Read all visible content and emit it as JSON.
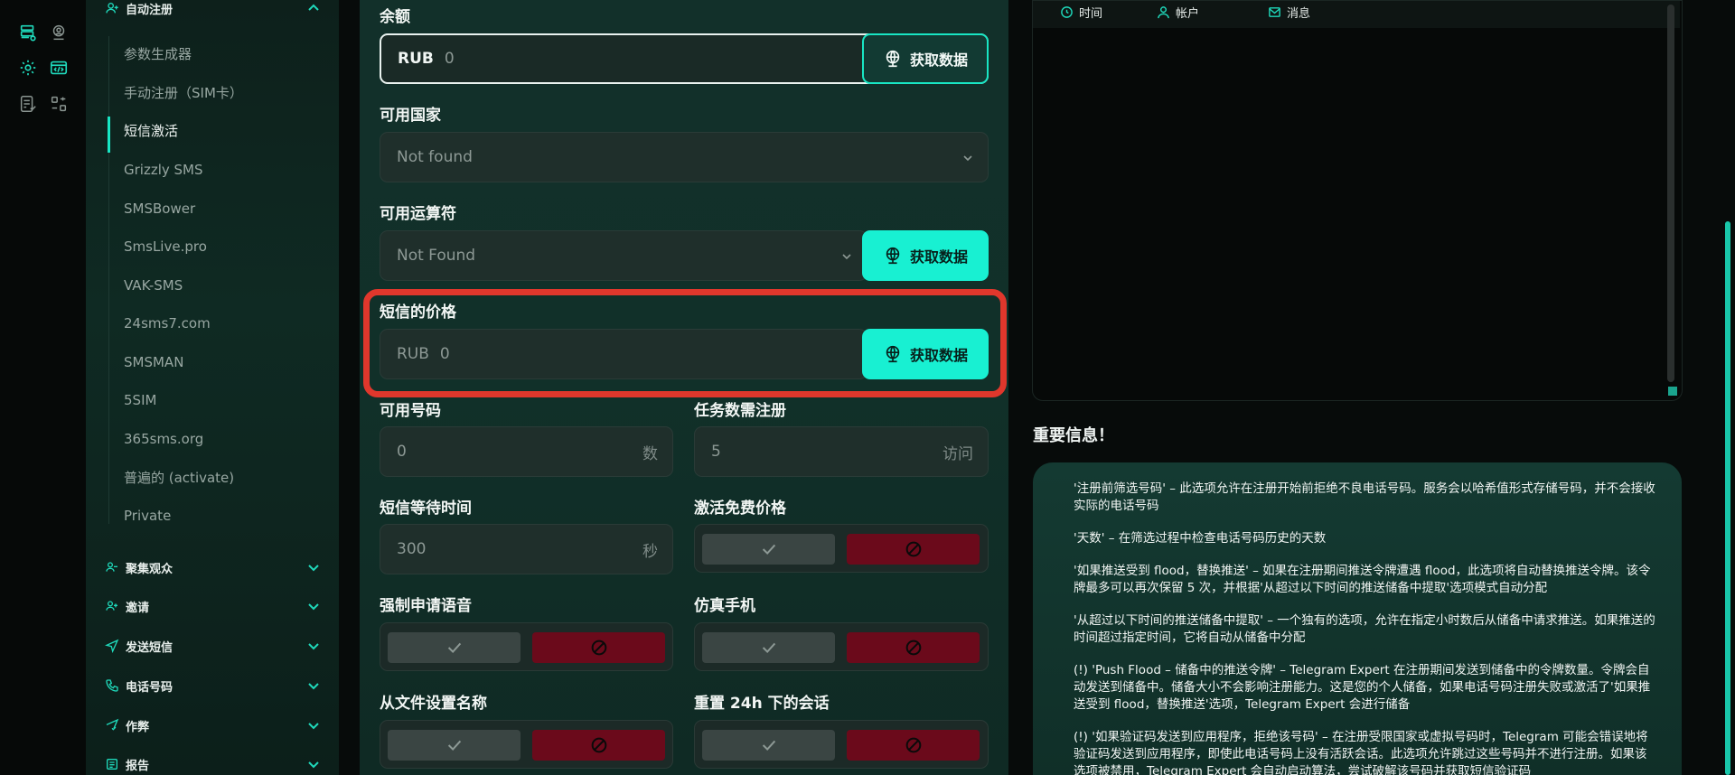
{
  "rail": {
    "icons": [
      "database-icon",
      "user-location-icon",
      "gear-icon",
      "code-window-icon",
      "checklist-icon",
      "layout-icon"
    ]
  },
  "sidebar": {
    "auto_register": "自动注册",
    "sub_items": [
      "参数生成器",
      "手动注册（SIM卡）",
      "短信激活",
      "Grizzly SMS",
      "SMSBower",
      "SmsLive.pro",
      "VAK-SMS",
      "24sms7.com",
      "SMSMAN",
      "5SIM",
      "365sms.org",
      "普遍的 (activate)",
      "Private"
    ],
    "sections": [
      "聚集观众",
      "邀请",
      "发送短信",
      "电话号码",
      "作弊",
      "报告"
    ]
  },
  "form": {
    "balance_label": "余额",
    "balance_prefix": "RUB",
    "balance_value": "0",
    "fetch_label": "获取数据",
    "countries_label": "可用国家",
    "countries_value": "Not found",
    "operators_label": "可用运算符",
    "operators_value": "Not Found",
    "sms_price_label": "短信的价格",
    "sms_price_prefix": "RUB",
    "sms_price_value": "0",
    "available_numbers_label": "可用号码",
    "available_numbers_value": "0",
    "available_numbers_suffix": "数",
    "tasks_label": "任务数需注册",
    "tasks_value": "5",
    "tasks_suffix": "访问",
    "sms_wait_label": "短信等待时间",
    "sms_wait_value": "300",
    "sms_wait_suffix": "秒",
    "free_price_label": "激活免费价格",
    "force_voice_label": "强制申请语音",
    "emulate_phone_label": "仿真手机",
    "name_from_file_label": "从文件设置名称",
    "reset_sessions_label": "重置 24h 下的会话"
  },
  "log_panel": {
    "tabs": [
      "时间",
      "帐户",
      "消息"
    ]
  },
  "info": {
    "title": "重要信息！",
    "paragraphs": [
      "'注册前筛选号码' – 此选项允许在注册开始前拒绝不良电话号码。服务会以哈希值形式存储号码，并不会接收实际的电话号码",
      "'天数' – 在筛选过程中检查电话号码历史的天数",
      "'如果推送受到 flood，替换推送' – 如果在注册期间推送令牌遭遇 flood，此选项将自动替换推送令牌。该令牌最多可以再次保留 5 次，并根据'从超过以下时间的推送储备中提取'选项模式自动分配",
      "'从超过以下时间的推送储备中提取' – 一个独有的选项，允许在指定小时数后从储备中请求推送。如果推送的时间超过指定时间，它将自动从储备中分配",
      "(!) 'Push Flood – 储备中的推送令牌' – Telegram Expert 在注册期间发送到储备中的令牌数量。令牌会自动发送到储备中。储备大小不会影响注册能力。这是您的个人储备，如果电话号码注册失败或激活了'如果推送受到 flood，替换推送'选项，Telegram Expert 会进行储备",
      "(!) '如果验证码发送到应用程序，拒绝该号码' – 在注册受限国家或虚拟号码时，Telegram 可能会错误地将验证码发送到应用程序，即使此电话号码上没有活跃会话。此选项允许跳过这些号码并不进行注册。如果该选项被禁用，Telegram Expert 会自动启动算法，尝试破解该号码并获取短信验证码"
    ]
  },
  "colors": {
    "accent": "#18f0d2",
    "danger": "#6b0a1b",
    "highlight": "#e0372c"
  }
}
